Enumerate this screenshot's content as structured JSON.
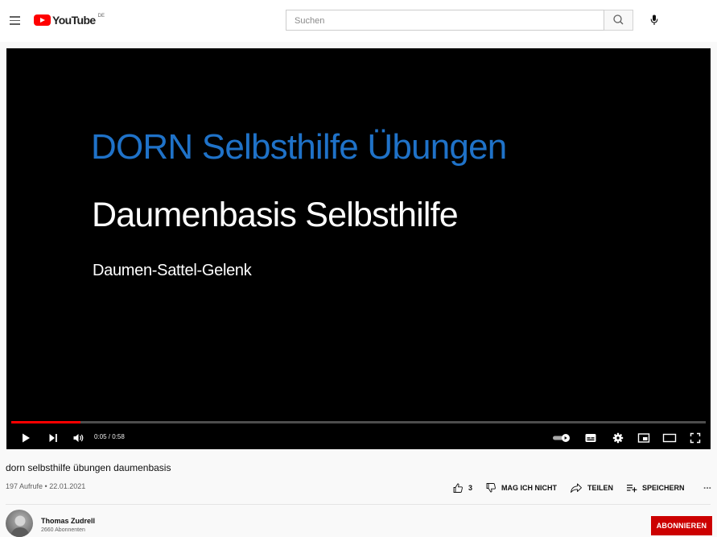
{
  "header": {
    "logo_text": "YouTube",
    "region_code": "DE",
    "search_placeholder": "Suchen"
  },
  "player": {
    "slide_title": "DORN Selbsthilfe Übungen",
    "slide_subtitle": "Daumenbasis Selbsthilfe",
    "slide_caption": "Daumen-Sattel-Gelenk",
    "time": "0:05 / 0:58",
    "progress": 0.1,
    "colors": {
      "title_blue": "#1f72c8",
      "progress_red": "#ff0000"
    }
  },
  "video": {
    "title": "dorn selbsthilfe übungen daumenbasis",
    "info": "197 Aufrufe • 22.01.2021",
    "like_count": "3",
    "dislike_label": "MAG ICH NICHT",
    "share_label": "TEILEN",
    "save_label": "SPEICHERN",
    "more_label": "..."
  },
  "channel": {
    "name": "Thomas Zudrell",
    "subscribers": "2660 Abonnenten",
    "subscribe_label": "ABONNIEREN",
    "subscribe_color": "#cc0000"
  }
}
